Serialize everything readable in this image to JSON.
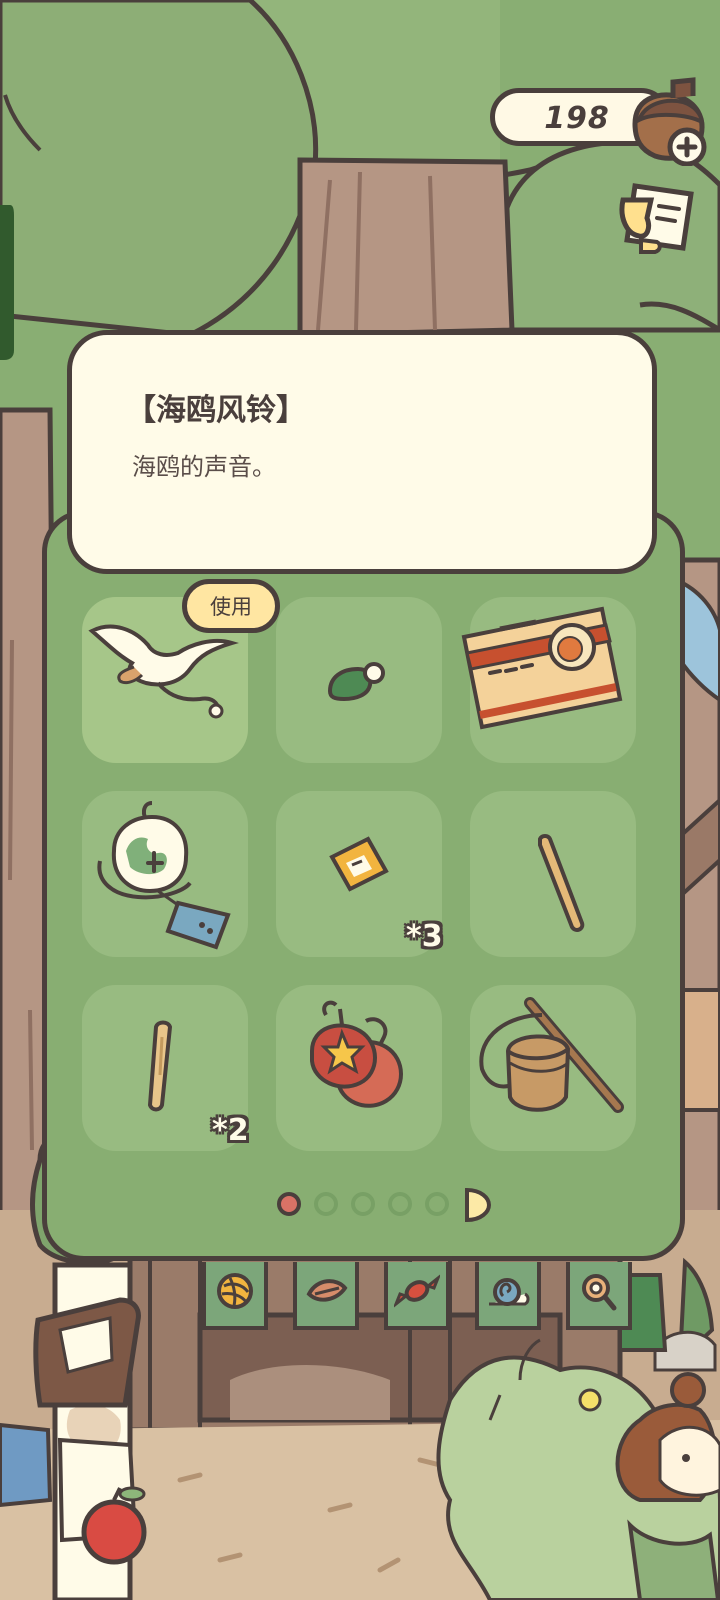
{
  "currency": {
    "clover_count": "198",
    "icon": "acorn-icon",
    "add_icon": "plus-icon"
  },
  "mail": {
    "icon": "mail-icon"
  },
  "item_detail": {
    "title": "【海鸥风铃】",
    "description": "海鸥的声音。"
  },
  "use_button": {
    "label": "使用"
  },
  "inventory": {
    "items": [
      {
        "icon": "seagull-chime-icon",
        "count": ""
      },
      {
        "icon": "green-hat-icon",
        "count": ""
      },
      {
        "icon": "gift-box-icon",
        "count": ""
      },
      {
        "icon": "glass-wind-chime-icon",
        "count": ""
      },
      {
        "icon": "ticket-icon",
        "count": "*3"
      },
      {
        "icon": "stick-icon",
        "count": ""
      },
      {
        "icon": "short-stick-icon",
        "count": "*2"
      },
      {
        "icon": "yo-yo-icon",
        "count": ""
      },
      {
        "icon": "acorn-bucket-icon",
        "count": ""
      }
    ]
  },
  "pagination": {
    "current_page": 1,
    "total_dots": 5
  },
  "tabs": [
    {
      "icon": "yarn-ball-icon"
    },
    {
      "icon": "leaf-icon"
    },
    {
      "icon": "candy-icon"
    },
    {
      "icon": "snail-icon"
    },
    {
      "icon": "magnifier-icon"
    }
  ],
  "palette": {
    "outline": "#4a3f3c",
    "card": "#fffbe8",
    "panel": "#88ae72",
    "slot": "#98bb81",
    "selected_slot": "#a6c689",
    "button": "#ffe6a2",
    "active_dot": "#d97266"
  }
}
